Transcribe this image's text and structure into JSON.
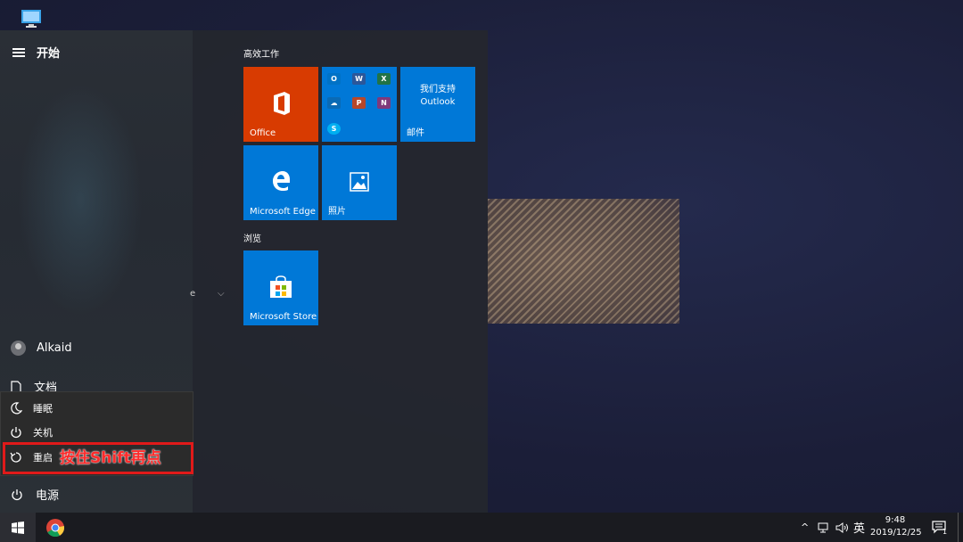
{
  "start_menu": {
    "title": "开始",
    "user": "Alkaid",
    "documents": "文档",
    "power": "电源",
    "power_menu": {
      "sleep": "睡眠",
      "shutdown": "关机",
      "restart": "重启",
      "annotation": "按住Shift再点"
    }
  },
  "tiles": {
    "group1_label": "高效工作",
    "group2_label": "浏览",
    "office": "Office",
    "outlook_line1": "我们支持",
    "outlook_line2": "Outlook",
    "mail": "邮件",
    "edge": "Microsoft Edge",
    "photos": "照片",
    "store": "Microsoft Store",
    "mini_apps": [
      "O",
      "W",
      "X",
      "",
      "P",
      "N",
      "S"
    ]
  },
  "taskbar": {
    "ime": "英",
    "time": "9:48",
    "date": "2019/12/25",
    "notifications": "1"
  },
  "colors": {
    "accent": "#0078d7",
    "office": "#d83b01",
    "highlight": "#e01a1a"
  }
}
